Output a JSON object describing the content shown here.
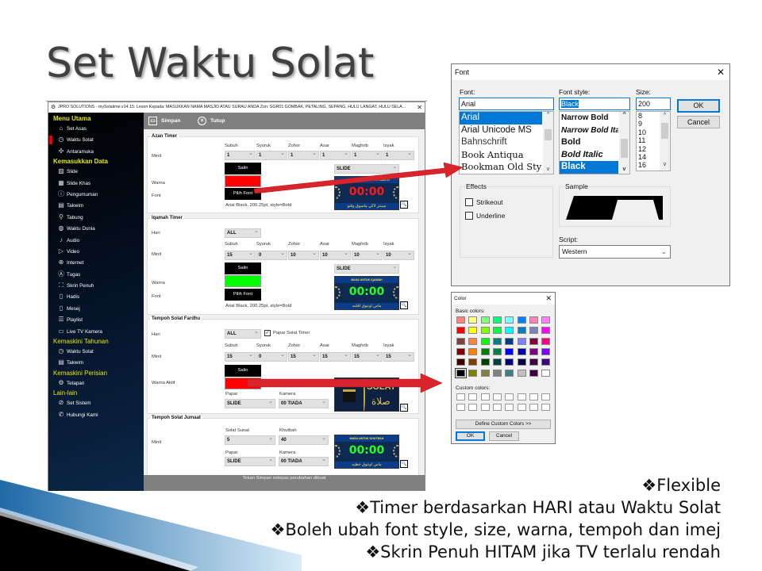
{
  "slide": {
    "title": "Set Waktu Solat",
    "bullet_glyph": "❖",
    "bullets": [
      "Flexible",
      "Timer berdasarkan HARI atau Waktu Solat",
      "Boleh ubah font style, size, warna, tempoh dan imej",
      "Skrin Penuh HITAM jika TV terlalu rendah"
    ],
    "arrow_color": "#d9242b"
  },
  "app": {
    "title": "JPRO SOLUTIONS - mySolatime.v14.15: Lesen Kepada: MASUKKAN NAMA MASJID ATAU SURAU ANDA Zon: SGR01:GOMBAK, PETALING, SEPANG, HULU LANGAT, HULU SELA...",
    "close": "✕",
    "sidebar": [
      {
        "type": "header",
        "label": "Menu Utama"
      },
      {
        "type": "item",
        "label": "Set Asas",
        "icon": "home-icon",
        "glyph": "⌂"
      },
      {
        "type": "item",
        "label": "Waktu Solat",
        "icon": "clock-icon",
        "glyph": "◷",
        "active": true
      },
      {
        "type": "item",
        "label": "Antaramuka",
        "icon": "puzzle-icon",
        "glyph": "✣"
      },
      {
        "type": "header",
        "label": "Kemasukkan Data"
      },
      {
        "type": "item",
        "label": "Slide",
        "icon": "image-icon",
        "glyph": "▨"
      },
      {
        "type": "item",
        "label": "Slide Khas",
        "icon": "slides-icon",
        "glyph": "▦"
      },
      {
        "type": "item",
        "label": "Pengumuman",
        "icon": "alert-icon",
        "glyph": "ⓘ"
      },
      {
        "type": "item",
        "label": "Takwim",
        "icon": "calendar-icon",
        "glyph": "▤"
      },
      {
        "type": "item",
        "label": "Tabung",
        "icon": "donation-box-icon",
        "glyph": "⚲"
      },
      {
        "type": "item",
        "label": "Waktu Dunia",
        "icon": "globe-icon",
        "glyph": "◍"
      },
      {
        "type": "item",
        "label": "Audio",
        "icon": "audio-file-icon",
        "glyph": "♪"
      },
      {
        "type": "item",
        "label": "Video",
        "icon": "video-file-icon",
        "glyph": "▷"
      },
      {
        "type": "item",
        "label": "Internet",
        "icon": "internet-icon",
        "glyph": "⊕"
      },
      {
        "type": "item",
        "label": "Tugas",
        "icon": "user-icon",
        "glyph": "Ⓐ"
      },
      {
        "type": "item",
        "label": "Skrin Penuh",
        "icon": "fullscreen-icon",
        "glyph": "⛶"
      },
      {
        "type": "item",
        "label": "Hadis",
        "icon": "book-icon",
        "glyph": "▯"
      },
      {
        "type": "item",
        "label": "Mesej",
        "icon": "document-icon",
        "glyph": "▯"
      },
      {
        "type": "item",
        "label": "Playlist",
        "icon": "playlist-icon",
        "glyph": "☰"
      },
      {
        "type": "item",
        "label": "Live TV Kamera",
        "icon": "camera-icon",
        "glyph": "▭"
      },
      {
        "type": "header",
        "label": "Kemaskini Tahunan",
        "light": true
      },
      {
        "type": "item",
        "label": "Waktu Solat",
        "icon": "clock-icon",
        "glyph": "◷"
      },
      {
        "type": "item",
        "label": "Takwim",
        "icon": "calendar-icon",
        "glyph": "▤"
      },
      {
        "type": "header",
        "label": "Kemaskini Perisian",
        "light": true
      },
      {
        "type": "item",
        "label": "Tetapan",
        "icon": "gear-icon",
        "glyph": "⚙"
      },
      {
        "type": "header",
        "label": "Lain-lain",
        "light": true
      },
      {
        "type": "item",
        "label": "Set Sistem",
        "icon": "wrench-icon",
        "glyph": "⊘"
      },
      {
        "type": "item",
        "label": "Hubungi Kami",
        "icon": "whatsapp-icon",
        "glyph": "✆"
      }
    ],
    "toolbar": {
      "save": "Simpan",
      "close": "Tutup"
    },
    "prayers": [
      "Subuh",
      "Syuruk",
      "Zohor",
      "Asar",
      "Maghrib",
      "Isyak"
    ],
    "labels": {
      "minit": "Minit",
      "warna": "Warna",
      "font": "Font",
      "hari": "Hari",
      "warna_aktif": "Warna Aktif",
      "papar": "Papar",
      "kamera": "Kamera",
      "solat_sunat": "Solat Sunat",
      "khutbah": "Khutbah",
      "salin": "Salin",
      "pilih_font": "Pilih Font"
    },
    "azan": {
      "title": "Azan Timer",
      "minutes": [
        "1",
        "1",
        "1",
        "1",
        "1",
        "1"
      ],
      "color": "#ff0000",
      "font_desc": "Arial Black, 200.25pt, style=Bold",
      "display": "SLIDE",
      "preview": {
        "top": "SEBENTAR LAGI MASUK WAKTU",
        "time": "00:00",
        "bottom": "سبنتر لاڬي ماسوق وقتو",
        "time_color": "#ff1a1a"
      }
    },
    "iqamah": {
      "title": "Iqamah Timer",
      "day": "ALL",
      "minutes": [
        "15",
        "0",
        "10",
        "10",
        "10",
        "10"
      ],
      "color": "#00ff00",
      "font_desc": "Arial Black, 200.25pt, style=Bold",
      "display": "SLIDE",
      "preview": {
        "top": "MASA UNTUK IQAMAH",
        "time": "00:00",
        "bottom": "ماس اونتوق اقامه",
        "time_color": "#22ff22"
      }
    },
    "fardhu": {
      "title": "Tempoh Solat Fardhu",
      "day": "ALL",
      "show_timer_label": "Papar Solat Timer",
      "show_timer": true,
      "minutes": [
        "15",
        "0",
        "15",
        "15",
        "15",
        "15"
      ],
      "active_color": "#ff0000",
      "display": "SLIDE",
      "camera": "00 TIADA",
      "preview": {
        "word": "SOLAT",
        "arabic": "صلاة"
      }
    },
    "jumaat": {
      "title": "Tempoh Solat Jumaat",
      "sunat": "5",
      "khutbah": "40",
      "display": "SLIDE",
      "camera": "00 TIADA",
      "preview": {
        "top": "MASA UNTUK KHUTBAH",
        "time": "00:00",
        "bottom": "ماس اونتوق خطبه",
        "time_color": "#22ff22"
      }
    },
    "status": "Tekan Simpan selepas perubahan dibuat"
  },
  "font_dialog": {
    "title": "Font",
    "font_label": "Font:",
    "font_value": "Arial",
    "fonts": [
      "Arial",
      "Arial Unicode MS",
      "Bahnschrift",
      "Book Antiqua",
      "Bookman Old Styl"
    ],
    "style_label": "Font style:",
    "style_value": "Black",
    "styles": [
      "Narrow Bold",
      "Narrow Bold Itali",
      "Bold",
      "Bold Italic",
      "Black"
    ],
    "size_label": "Size:",
    "size_value": "200",
    "sizes": [
      "8",
      "9",
      "10",
      "11",
      "12",
      "14",
      "16"
    ],
    "ok": "OK",
    "cancel": "Cancel",
    "effects_label": "Effects",
    "strikeout": "Strikeout",
    "underline": "Underline",
    "sample_label": "Sample",
    "script_label": "Script:",
    "script_value": "Western"
  },
  "color_dialog": {
    "title": "Color",
    "basic_label": "Basic colors:",
    "basic_colors": [
      "#FF8080",
      "#FFFF80",
      "#80FF80",
      "#00FF80",
      "#80FFFF",
      "#0080FF",
      "#FF80C0",
      "#FF80FF",
      "#FF0000",
      "#FFFF00",
      "#80FF00",
      "#00FF40",
      "#00FFFF",
      "#0080C0",
      "#8080C0",
      "#FF00FF",
      "#804040",
      "#FF8040",
      "#00FF00",
      "#008080",
      "#004080",
      "#8080FF",
      "#800040",
      "#FF0080",
      "#800000",
      "#FF8000",
      "#008000",
      "#008040",
      "#0000FF",
      "#0000A0",
      "#800080",
      "#8000FF",
      "#400000",
      "#804000",
      "#004000",
      "#004040",
      "#000080",
      "#000040",
      "#400040",
      "#400080",
      "#000000",
      "#808000",
      "#808040",
      "#808080",
      "#408080",
      "#C0C0C0",
      "#400040",
      "#FFFFFF"
    ],
    "selected_color": "#000000",
    "custom_label": "Custom colors:",
    "define_custom": "Define Custom Colors >>",
    "ok": "OK",
    "cancel": "Cancel"
  }
}
